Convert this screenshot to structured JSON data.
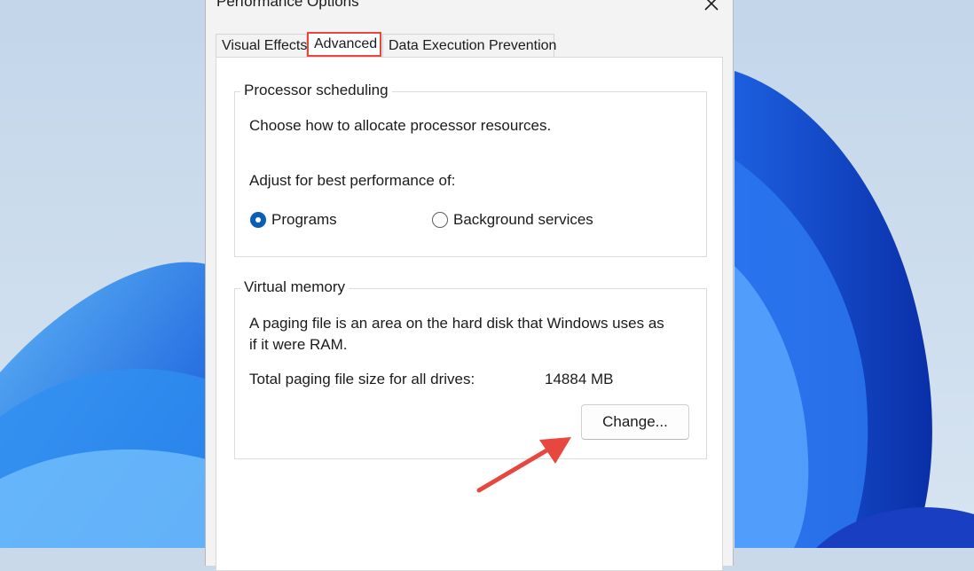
{
  "dialog": {
    "title": "Performance Options",
    "close_icon": "close-icon"
  },
  "tabs": [
    {
      "label": "Visual Effects"
    },
    {
      "label": "Advanced",
      "selected": true
    },
    {
      "label": "Data Execution Prevention"
    }
  ],
  "processor": {
    "group_label": "Processor scheduling",
    "description": "Choose how to allocate processor resources.",
    "adjust_label": "Adjust for best performance of:",
    "options": [
      {
        "label": "Programs",
        "checked": true
      },
      {
        "label": "Background services",
        "checked": false
      }
    ]
  },
  "virtual_memory": {
    "group_label": "Virtual memory",
    "description_line1": "A paging file is an area on the hard disk that Windows uses as",
    "description_line2": "if it were RAM.",
    "total_label": "Total paging file size for all drives:",
    "total_value": "14884 MB",
    "change_button": "Change..."
  },
  "colors": {
    "highlight": "#e8473f",
    "accent": "#0a5fb4"
  }
}
